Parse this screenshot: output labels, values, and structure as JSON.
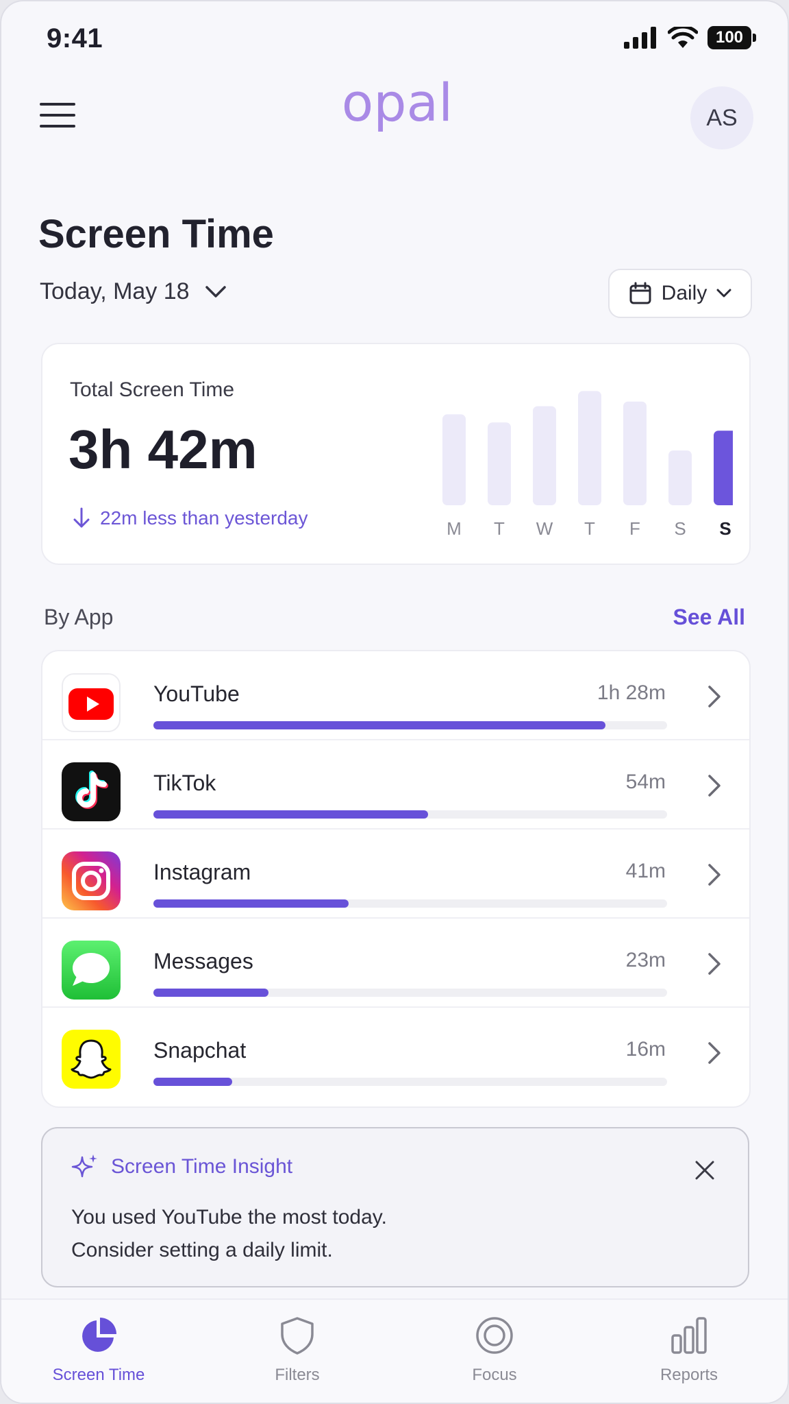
{
  "status_bar": {
    "time": "9:41",
    "battery": "100"
  },
  "header": {
    "logo_text": "opal",
    "avatar_initials": "AS"
  },
  "page_title": "Screen Time",
  "date_selector": {
    "label": "Today, May 18"
  },
  "period_selector": {
    "label": "Daily"
  },
  "summary": {
    "label": "Total Screen Time",
    "total": "3h 42m",
    "delta": "22m less than yesterday"
  },
  "chart_data": {
    "type": "bar",
    "categories": [
      "M",
      "T",
      "W",
      "T",
      "F",
      "S",
      "S"
    ],
    "values": [
      0.78,
      0.71,
      0.85,
      0.98,
      0.89,
      0.47,
      0.64
    ],
    "highlight_index": 6,
    "colors": {
      "default": "#eceaf9",
      "highlight": "#6c55dc"
    }
  },
  "by_app": {
    "title": "By App",
    "see_all": "See All",
    "apps": [
      {
        "name": "YouTube",
        "time": "1h 28m",
        "share": 0.88,
        "icon": "youtube-icon"
      },
      {
        "name": "TikTok",
        "time": "54m",
        "share": 0.534,
        "icon": "tiktok-icon"
      },
      {
        "name": "Instagram",
        "time": "41m",
        "share": 0.38,
        "icon": "instagram-icon"
      },
      {
        "name": "Messages",
        "time": "23m",
        "share": 0.224,
        "icon": "messages-icon"
      },
      {
        "name": "Snapchat",
        "time": "16m",
        "share": 0.153,
        "icon": "snapchat-icon"
      }
    ]
  },
  "insight": {
    "title": "Screen Time Insight",
    "line1": "You used YouTube the most today.",
    "line2": "Consider setting a daily limit."
  },
  "tabs": [
    {
      "label": "Screen Time",
      "icon": "pie-chart-icon",
      "active": true
    },
    {
      "label": "Filters",
      "icon": "shield-icon",
      "active": false
    },
    {
      "label": "Focus",
      "icon": "focus-target-icon",
      "active": false
    },
    {
      "label": "Reports",
      "icon": "bar-chart-icon",
      "active": false
    }
  ],
  "colors": {
    "accent": "#6650d8",
    "background": "#f7f7fb"
  }
}
